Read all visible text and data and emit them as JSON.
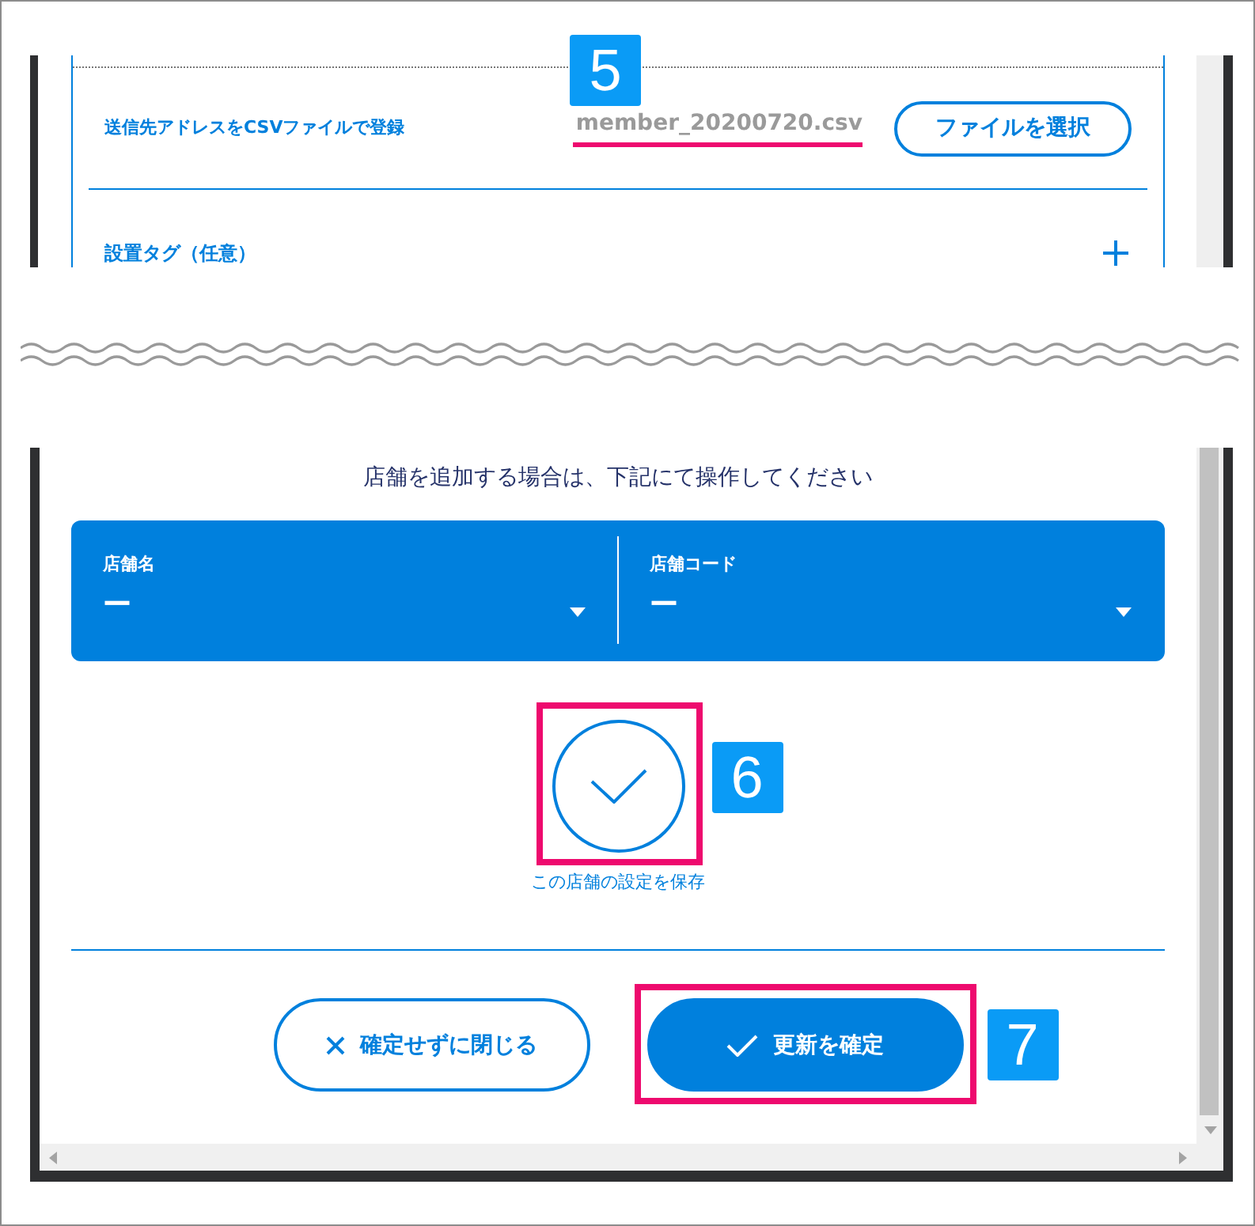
{
  "upload_row": {
    "label": "送信先アドレスをCSVファイルで登録",
    "file_name": "member_20200720.csv",
    "highlighted": true,
    "badge": "5",
    "button": "ファイルを選択"
  },
  "tag_section": {
    "label": "設置タグ（任意）",
    "expanded": false
  },
  "dialog": {
    "instruction": "店舗を追加する場合は、下記にて操作してください",
    "fields": [
      {
        "label": "店舗名",
        "value": "ー"
      },
      {
        "label": "店舗コード",
        "value": "ー"
      }
    ],
    "save_store": {
      "highlighted": true,
      "badge": "6",
      "caption": "この店舗の設定を保存"
    },
    "buttons": [
      {
        "kind": "close",
        "label": "確定せずに閉じる",
        "highlighted": false
      },
      {
        "kind": "confirm",
        "label": "更新を確定",
        "highlighted": true,
        "badge": "7"
      }
    ]
  }
}
